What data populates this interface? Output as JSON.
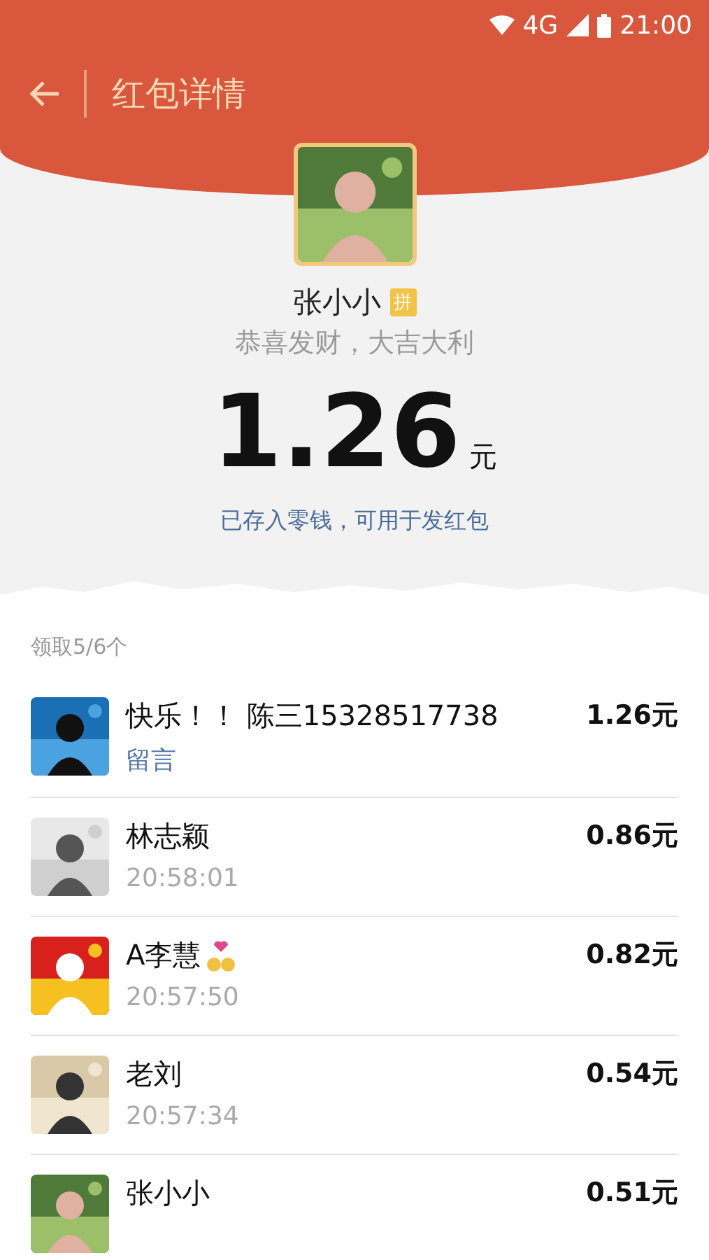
{
  "status_bar": {
    "network": "4G",
    "time": "21:00"
  },
  "header": {
    "title": "红包详情"
  },
  "sender": {
    "name": "张小小",
    "badge": "拼",
    "greeting": "恭喜发财，大吉大利",
    "amount": "1.26",
    "unit": "元",
    "note": "已存入零钱，可用于发红包"
  },
  "summary": "领取5/6个",
  "rows": [
    {
      "name": "快乐！！ 陈三15328517738",
      "sub": "留言",
      "kind": "message",
      "amount": "1.26元",
      "emoji": false
    },
    {
      "name": "林志颖",
      "sub": "20:58:01",
      "kind": "time",
      "amount": "0.86元",
      "emoji": false
    },
    {
      "name": "A李慧",
      "sub": "20:57:50",
      "kind": "time",
      "amount": "0.82元",
      "emoji": true
    },
    {
      "name": "老刘",
      "sub": "20:57:34",
      "kind": "time",
      "amount": "0.54元",
      "emoji": false
    },
    {
      "name": "张小小",
      "kind": "cut",
      "amount": "0.51元",
      "emoji": false
    }
  ]
}
